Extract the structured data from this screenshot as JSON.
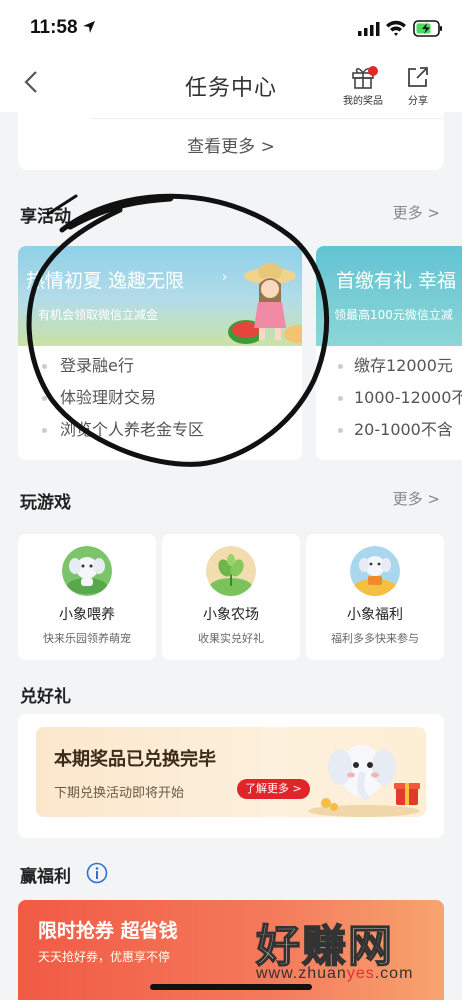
{
  "status_bar": {
    "time": "11:58"
  },
  "nav": {
    "title": "任务中心",
    "prize_label": "我的奖品",
    "share_label": "分享"
  },
  "top_card": {
    "see_more": "查看更多 >"
  },
  "activities": {
    "title": "享活动",
    "more": "更多 >",
    "cards": [
      {
        "title": "热情初夏 逸趣无限",
        "subtitle": "有机会领取微信立减金",
        "items": [
          "登录融e行",
          "体验理财交易",
          "浏览个人养老金专区"
        ]
      },
      {
        "title": "首缴有礼 幸福",
        "subtitle": "领最高100元微信立减",
        "items": [
          "缴存12000元",
          "1000-12000不",
          "20-1000不含"
        ]
      }
    ]
  },
  "games": {
    "title": "玩游戏",
    "more": "更多 >",
    "items": [
      {
        "name": "小象喂养",
        "desc": "快来乐园领养萌宠"
      },
      {
        "name": "小象农场",
        "desc": "收果实兑好礼"
      },
      {
        "name": "小象福利",
        "desc": "福利多多快来参与"
      }
    ]
  },
  "exchange": {
    "title": "兑好礼",
    "banner_title": "本期奖品已兑换完毕",
    "banner_sub": "下期兑换活动即将开始",
    "button": "了解更多 >"
  },
  "welfare": {
    "title": "赢福利",
    "banner_title": "限时抢券 超省钱",
    "banner_sub": "天天抢好券，优惠享不停"
  },
  "watermark": {
    "brand": "好赚网",
    "url_prefix": "www.zhuan",
    "url_mid": "yes",
    "url_suffix": ".com"
  }
}
